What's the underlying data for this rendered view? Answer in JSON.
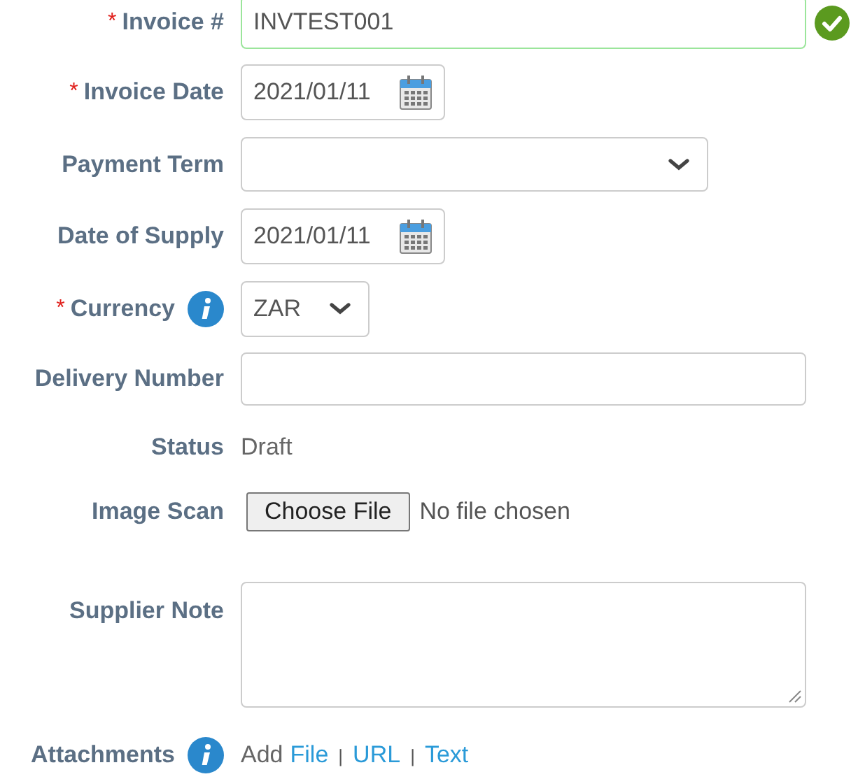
{
  "required_mark": "*",
  "fields": [
    {
      "kind": "text",
      "label": "Invoice #",
      "required": true,
      "info": false,
      "value": "INVTEST001",
      "valid": true
    },
    {
      "kind": "date",
      "label": "Invoice Date",
      "required": true,
      "info": false,
      "value": "2021/01/11"
    },
    {
      "kind": "select",
      "label": "Payment Term",
      "required": false,
      "info": false
    },
    {
      "kind": "date",
      "label": "Date of Supply",
      "required": false,
      "info": false,
      "value": "2021/01/11"
    },
    {
      "kind": "currency",
      "label": "Currency",
      "required": true,
      "info": true,
      "value": "ZAR"
    },
    {
      "kind": "text",
      "label": "Delivery Number",
      "required": false,
      "info": false,
      "valid": false
    },
    {
      "kind": "static",
      "label": "Status",
      "required": false,
      "info": false,
      "value": "Draft"
    },
    {
      "kind": "file",
      "label": "Image Scan",
      "required": false,
      "info": false,
      "button": "Choose File",
      "note": "No file chosen"
    },
    {
      "kind": "textarea",
      "label": "Supplier Note",
      "required": false,
      "info": false
    },
    {
      "kind": "links",
      "label": "Attachments",
      "required": false,
      "info": true,
      "prefix": "Add",
      "separator": "|",
      "links": [
        "File",
        "URL",
        "Text"
      ]
    }
  ]
}
